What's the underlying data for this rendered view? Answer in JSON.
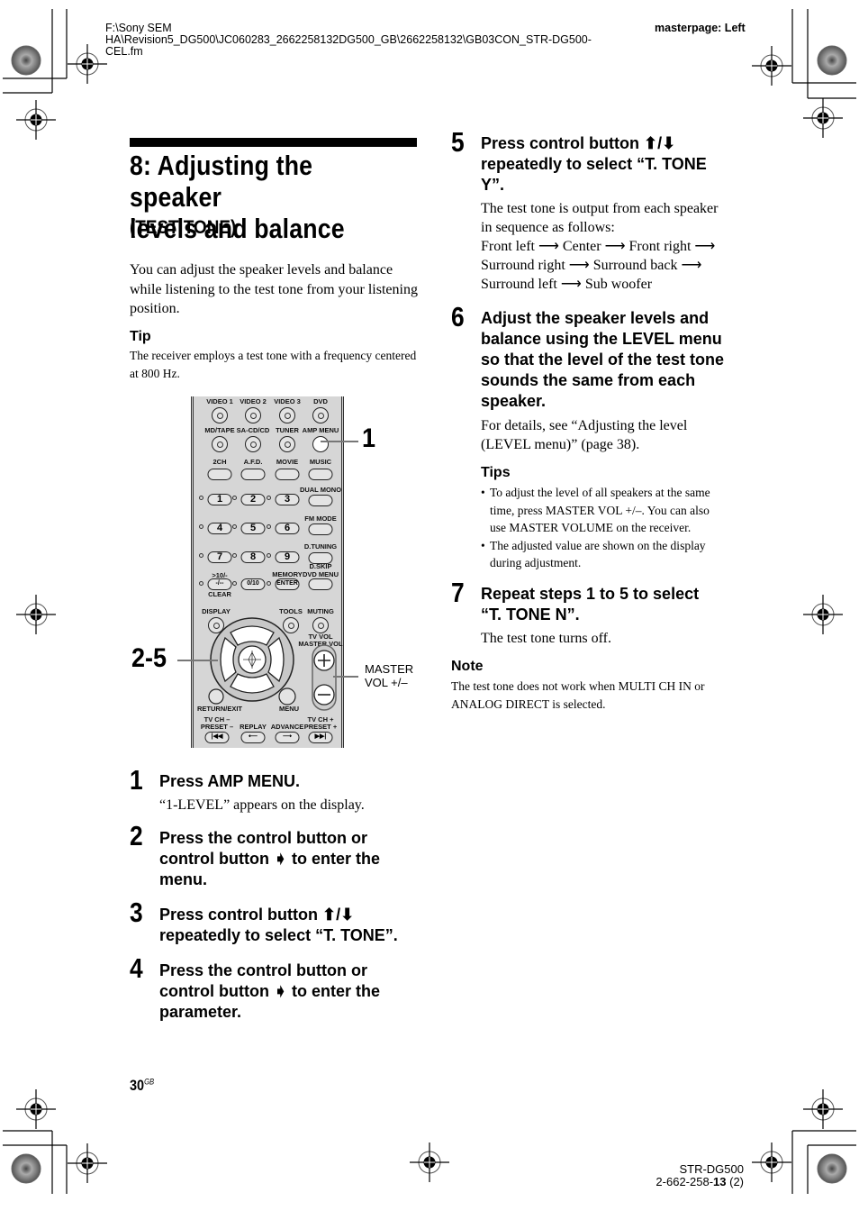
{
  "header": {
    "file_path_lines": [
      "F:\\Sony SEM",
      "HA\\Revision5_DG500\\JC060283_2662258132DG500_GB\\2662258132\\GB03CON_STR-DG500-",
      "CEL.fm"
    ],
    "masterpage": "masterpage: Left"
  },
  "section": {
    "title_line1": "8: Adjusting the speaker",
    "title_line2": "levels and balance",
    "subtitle": "(TEST TONE)",
    "intro": "You can adjust the speaker levels and balance while listening to the test tone from your listening position.",
    "tip_heading": "Tip",
    "tip_text": "The receiver employs a test tone with a frequency centered at 800 Hz."
  },
  "remote": {
    "row1": [
      "VIDEO 1",
      "VIDEO 2",
      "VIDEO 3",
      "DVD"
    ],
    "row2": [
      "MD/TAPE",
      "SA-CD/CD",
      "TUNER",
      "AMP MENU"
    ],
    "row3": [
      "2CH",
      "A.F.D.",
      "MOVIE",
      "MUSIC"
    ],
    "dual_mono": "DUAL MONO",
    "fm_mode": "FM MODE",
    "d_tuning": "D.TUNING",
    "d_skip": "D.SKIP",
    "dvd_menu": "DVD MENU",
    "numbers": [
      "1",
      "2",
      "3",
      "4",
      "5",
      "6",
      "7",
      "8",
      "9"
    ],
    "ten_label": ">10/-",
    "ten_btn": "-/--",
    "clear": "CLEAR",
    "zero_btn": "0/10",
    "memory": "MEMORY",
    "enter_btn": "ENTER",
    "display": "DISPLAY",
    "tools": "TOOLS",
    "muting": "MUTING",
    "tv_vol": "TV VOL",
    "master_vol": "MASTER VOL",
    "return_exit": "RETURN/EXIT",
    "menu": "MENU",
    "tv_ch_minus": "TV CH –",
    "preset_minus": "PRESET –",
    "replay": "REPLAY",
    "advance": "ADVANCE",
    "tv_ch_plus": "TV CH +",
    "preset_plus": "PRESET +",
    "callout_1": "1",
    "callout_2_5": "2-5",
    "master_vol_callout": [
      "MASTER",
      "VOL +/–"
    ]
  },
  "steps_left": [
    {
      "num": "1",
      "title": "Press AMP MENU.",
      "desc": "“1-LEVEL” appears on the display."
    },
    {
      "num": "2",
      "title_lines": [
        "Press the control button or",
        "control button ➧ to enter the",
        "menu."
      ]
    },
    {
      "num": "3",
      "title_lines": [
        "Press control button ⬆/⬇",
        "repeatedly to select “T. TONE”."
      ]
    },
    {
      "num": "4",
      "title_lines": [
        "Press the control button or",
        "control button ➧ to enter the",
        "parameter."
      ]
    }
  ],
  "steps_right": [
    {
      "num": "5",
      "title_lines": [
        "Press control button ⬆/⬇",
        "repeatedly to select “T. TONE",
        "Y”."
      ],
      "desc_lines": [
        "The test tone is output from each speaker",
        "in sequence as follows:",
        "Front left ⟶ Center ⟶ Front right ⟶",
        "Surround right ⟶ Surround back ⟶",
        "Surround left ⟶ Sub woofer"
      ]
    },
    {
      "num": "6",
      "title_lines": [
        "Adjust the speaker levels and",
        "balance using the LEVEL menu",
        "so that the level of the test tone",
        "sounds the same from each",
        "speaker."
      ],
      "desc_lines": [
        "For details, see “Adjusting the level",
        "(LEVEL menu)” (page 38)."
      ]
    },
    {
      "num": "7",
      "title_lines": [
        "Repeat steps 1 to 5 to select",
        "“T. TONE N”."
      ],
      "desc": "The test tone turns off."
    }
  ],
  "tips": {
    "heading": "Tips",
    "items": [
      [
        "To adjust the level of all speakers at the same",
        "time, press MASTER VOL +/–. You can also",
        "use MASTER VOLUME on the receiver."
      ],
      [
        "The adjusted value are shown on the display",
        "during adjustment."
      ]
    ]
  },
  "note": {
    "heading": "Note",
    "lines": [
      "The test tone does not work when MULTI CH IN or",
      "ANALOG DIRECT is selected."
    ]
  },
  "footer": {
    "page_number": "30",
    "page_suffix": "GB",
    "model": "STR-DG500",
    "part_number_prefix": "2-662-258-",
    "part_number_bold": "13",
    "part_number_suffix": " (2)"
  }
}
